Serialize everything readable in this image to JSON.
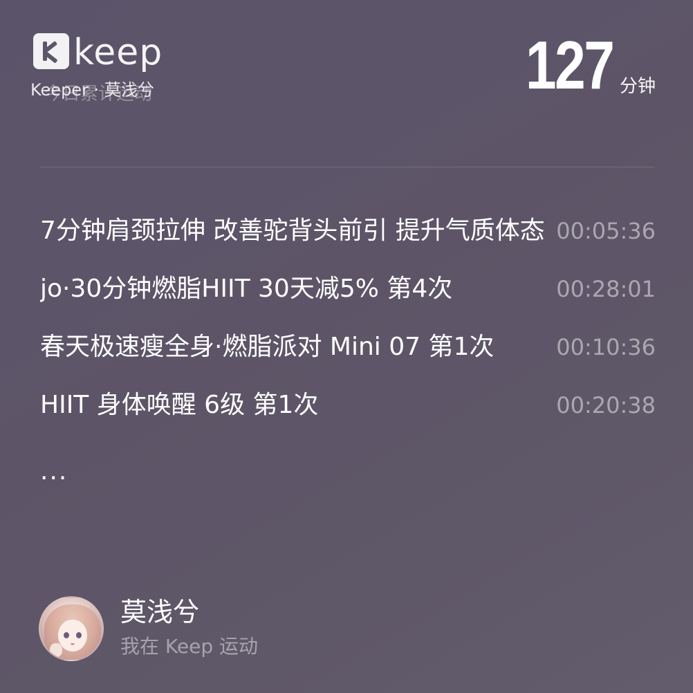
{
  "header": {
    "brand": "keep",
    "subtitle": "Keeper · 莫浅兮",
    "subtitle_ghost": "今日累计运动",
    "total_value": "127",
    "total_unit": "分钟"
  },
  "records": [
    {
      "name": "7分钟肩颈拉伸 改善驼背头前引 提升气质体态",
      "time": "00:05:36"
    },
    {
      "name": "jo·30分钟燃脂HIIT 30天减5% 第4次",
      "time": "00:28:01"
    },
    {
      "name": "春天极速瘦全身·燃脂派对 Mini 07 第1次",
      "time": "00:10:36"
    },
    {
      "name": "HIIT 身体唤醒 6级 第1次",
      "time": "00:20:38"
    }
  ],
  "more": "...",
  "footer": {
    "username": "莫浅兮",
    "tagline": "我在 Keep 运动"
  },
  "colors": {
    "background": "#5d5568",
    "text_primary": "#ffffff",
    "text_secondary": "#a49eac"
  },
  "icons": {
    "logo": "keep-logo-icon",
    "avatar": "user-avatar"
  }
}
